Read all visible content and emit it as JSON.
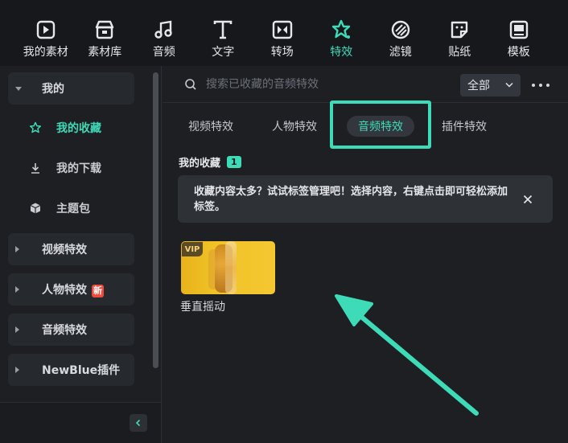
{
  "toolbar": {
    "items": [
      {
        "label": "我的素材",
        "icon": "my-media-icon"
      },
      {
        "label": "素材库",
        "icon": "stock-media-icon"
      },
      {
        "label": "音频",
        "icon": "audio-icon"
      },
      {
        "label": "文字",
        "icon": "text-icon"
      },
      {
        "label": "转场",
        "icon": "transition-icon"
      },
      {
        "label": "特效",
        "icon": "effects-icon",
        "active": true
      },
      {
        "label": "滤镜",
        "icon": "filter-icon"
      },
      {
        "label": "贴纸",
        "icon": "sticker-icon"
      },
      {
        "label": "模板",
        "icon": "template-icon"
      }
    ]
  },
  "sidebar": {
    "mine_group": "我的",
    "favorites": "我的收藏",
    "downloads": "我的下载",
    "theme_packs": "主题包",
    "groups": [
      {
        "label": "视频特效"
      },
      {
        "label": "人物特效",
        "badge": "新"
      },
      {
        "label": "音频特效"
      },
      {
        "label": "NewBlue插件"
      }
    ]
  },
  "search": {
    "placeholder": "搜索已收藏的音频特效",
    "filter_value": "全部"
  },
  "tabs": [
    {
      "label": "视频特效"
    },
    {
      "label": "人物特效"
    },
    {
      "label": "音频特效",
      "active": true
    },
    {
      "label": "插件特效"
    }
  ],
  "favorites_section": {
    "title": "我的收藏",
    "count": "1",
    "notice": "收藏内容太多？试试标签管理吧！选择内容，右键点击即可轻松添加标签。"
  },
  "items": [
    {
      "name": "垂直摇动",
      "badge": "VIP"
    }
  ],
  "colors": {
    "accent": "#3ddbb8",
    "background": "#1d1f23",
    "toolbar_bg": "#16181b"
  }
}
